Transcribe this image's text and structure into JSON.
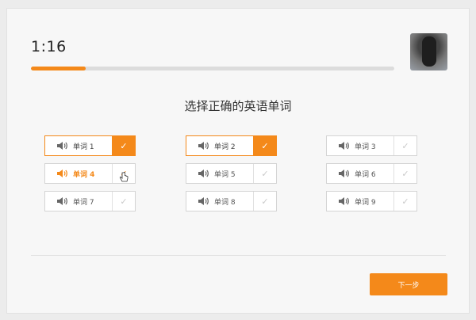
{
  "timer": "1:16",
  "progress": 0.15,
  "prompt": "选择正确的英语单词",
  "words": [
    {
      "label": "单词 1",
      "state": "selected"
    },
    {
      "label": "单词 2",
      "state": "selected"
    },
    {
      "label": "单词 3",
      "state": "normal"
    },
    {
      "label": "单词 4",
      "state": "active"
    },
    {
      "label": "单词 5",
      "state": "normal"
    },
    {
      "label": "单词 6",
      "state": "normal"
    },
    {
      "label": "单词 7",
      "state": "normal"
    },
    {
      "label": "单词 8",
      "state": "normal"
    },
    {
      "label": "单词 9",
      "state": "normal"
    }
  ],
  "next_label": "下一步",
  "colors": {
    "accent": "#f4891a",
    "track": "#dcdcdc"
  },
  "icons": {
    "sound": "speaker-icon",
    "check": "checkmark-icon"
  }
}
